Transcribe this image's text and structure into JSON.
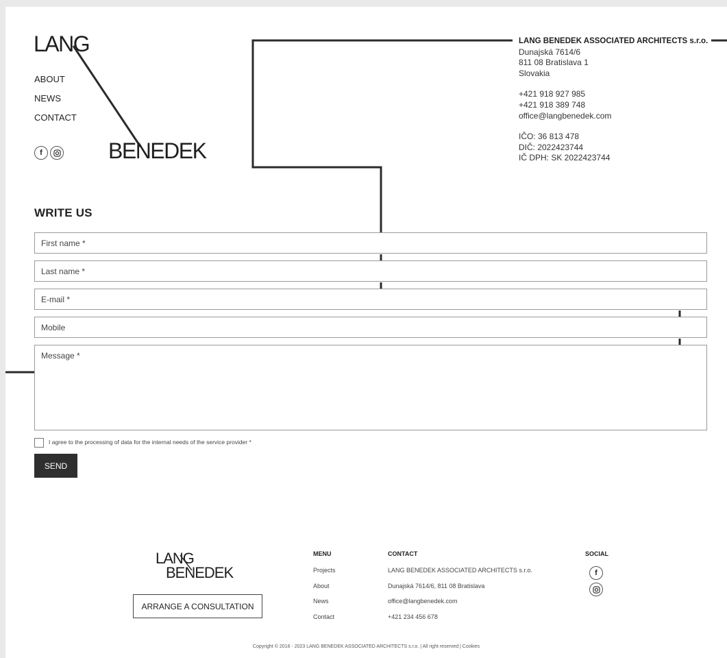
{
  "header": {
    "logo_top": "LANG",
    "logo_bottom": "BENEDEK"
  },
  "nav": {
    "items": [
      {
        "label": "ABOUT"
      },
      {
        "label": "NEWS"
      },
      {
        "label": "CONTACT"
      }
    ]
  },
  "social": {
    "facebook_glyph": "f",
    "instagram_glyph": "◎",
    "icons": [
      "facebook-icon",
      "instagram-icon"
    ]
  },
  "company": {
    "name": "LANG BENEDEK ASSOCIATED ARCHITECTS s.r.o.",
    "address_line1": "Dunajská 7614/6",
    "address_line2": "811 08 Bratislava 1",
    "country": "Slovakia",
    "phone1": "+421 918 927 985",
    "phone2": "+421 918 389 748",
    "email": "office@langbenedek.com",
    "ico": "IČO: 36 813 478",
    "dic": "DIČ: 2022423744",
    "ic_dph": "IČ DPH: SK 2022423744"
  },
  "form": {
    "title": "WRITE US",
    "first_name_placeholder": "First name *",
    "last_name_placeholder": "Last name *",
    "email_placeholder": "E-mail *",
    "mobile_placeholder": "Mobile",
    "message_placeholder": "Message *",
    "agree_label": "I agree to the processing of data for the internal needs of the service provider *",
    "send_label": "SEND"
  },
  "footer": {
    "logo_top": "LANG",
    "logo_bottom": "BENEDEK",
    "consult_label": "ARRANGE A CONSULTATION",
    "menu_title": "MENU",
    "menu_items": [
      {
        "label": "Projects"
      },
      {
        "label": "About"
      },
      {
        "label": "News"
      },
      {
        "label": "Contact"
      }
    ],
    "contact_title": "CONTACT",
    "contact_lines": [
      {
        "text": "LANG BENEDEK ASSOCIATED ARCHITECTS s.r.o."
      },
      {
        "text": "Dunajská 7614/6, 811 08 Bratislava"
      },
      {
        "text": "office@langbenedek.com"
      },
      {
        "text": "+421 234 456 678"
      }
    ],
    "social_title": "SOCIAL",
    "copyright": "Copyright © 2016 - 2023 LANG BENEDEK ASSOCIATED ARCHITECTS s.r.o. | All right reserved | Cookies"
  },
  "colors": {
    "accent": "#2f2f2f",
    "background": "#ffffff",
    "frame": "#e9e9e9"
  }
}
